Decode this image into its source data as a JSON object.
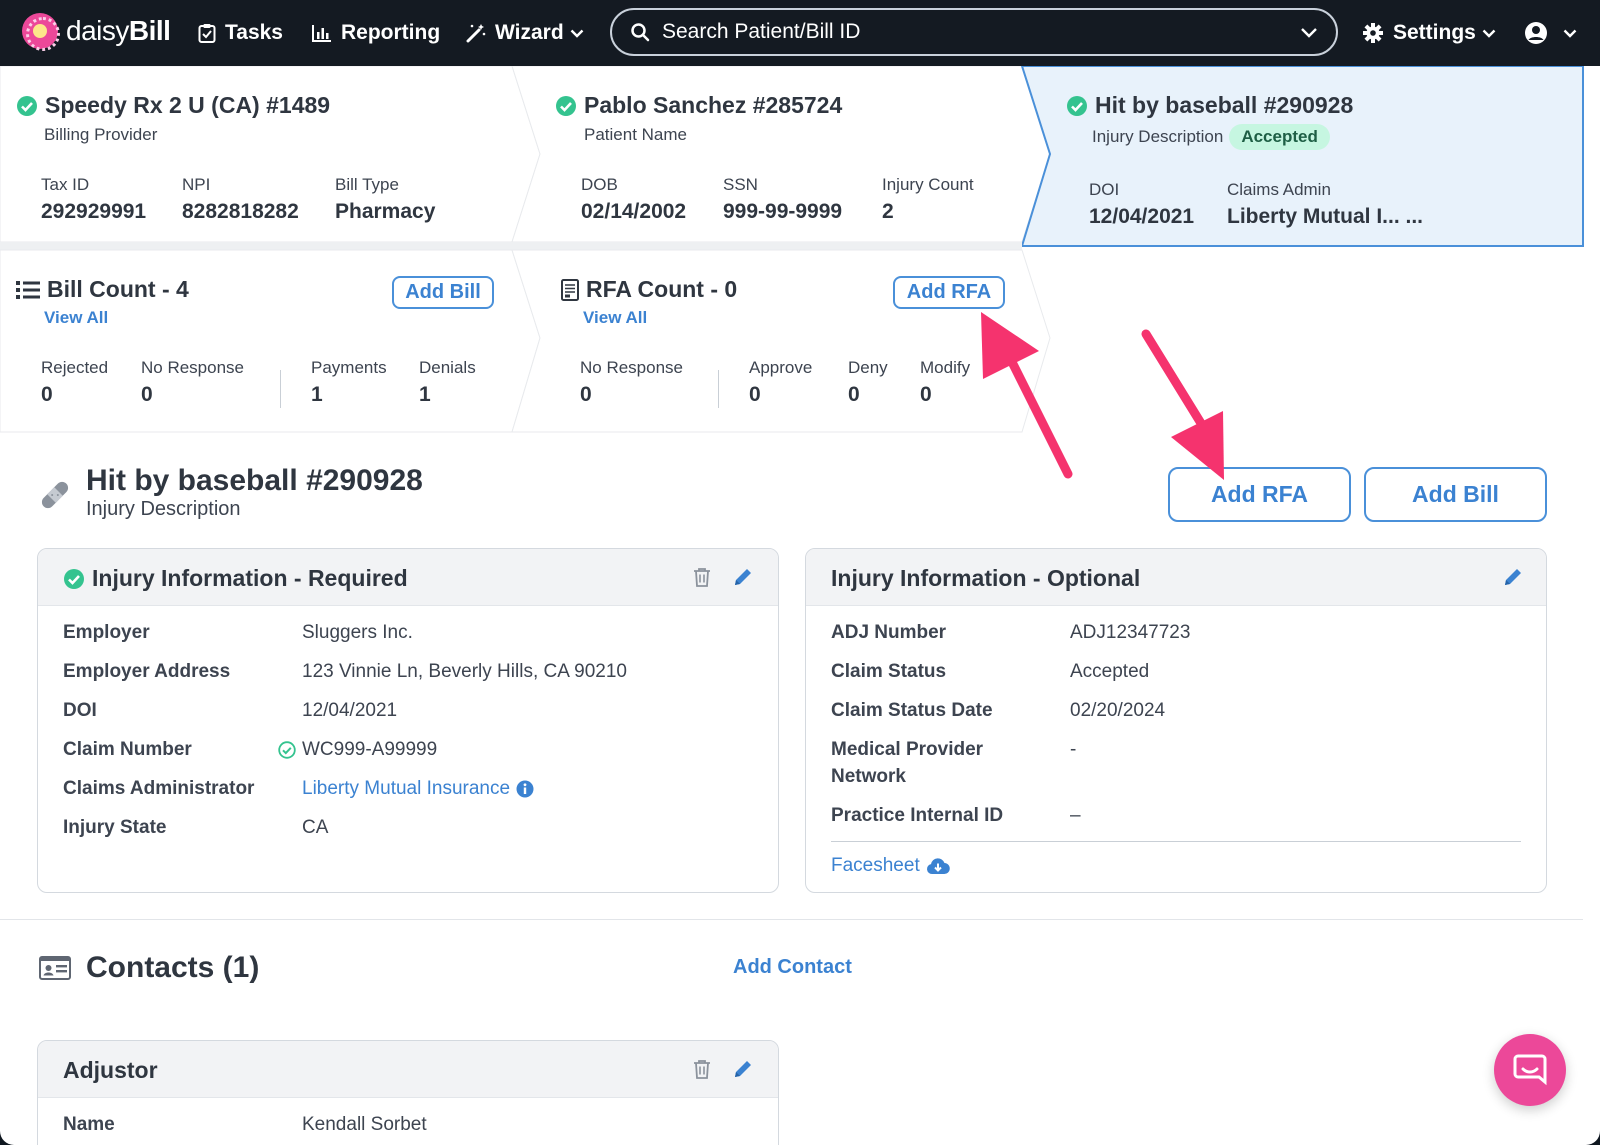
{
  "nav": {
    "brand_light": "daisy",
    "brand_bold": "Bill",
    "tasks": "Tasks",
    "reporting": "Reporting",
    "wizard": "Wizard",
    "search_placeholder": "Search Patient/Bill ID",
    "settings": "Settings"
  },
  "provider": {
    "title": "Speedy Rx 2 U (CA) #1489",
    "subtitle": "Billing Provider",
    "fields": [
      {
        "label": "Tax ID",
        "value": "292929991"
      },
      {
        "label": "NPI",
        "value": "8282818282"
      },
      {
        "label": "Bill Type",
        "value": "Pharmacy"
      }
    ]
  },
  "patient": {
    "title": "Pablo Sanchez #285724",
    "subtitle": "Patient Name",
    "fields": [
      {
        "label": "DOB",
        "value": "02/14/2002"
      },
      {
        "label": "SSN",
        "value": "999-99-9999"
      },
      {
        "label": "Injury Count",
        "value": "2"
      }
    ]
  },
  "injury_panel": {
    "title": "Hit by baseball #290928",
    "subtitle": "Injury Description",
    "badge": "Accepted",
    "fields": [
      {
        "label": "DOI",
        "value": "12/04/2021"
      },
      {
        "label": "Claims Admin",
        "value": "Liberty Mutual I... ..."
      }
    ]
  },
  "bills": {
    "title": "Bill Count - 4",
    "view_all": "View All",
    "add_label": "Add Bill",
    "stats": [
      {
        "label": "Rejected",
        "value": "0"
      },
      {
        "label": "No Response",
        "value": "0"
      },
      {
        "label": "Payments",
        "value": "1"
      },
      {
        "label": "Denials",
        "value": "1"
      }
    ]
  },
  "rfa": {
    "title": "RFA Count - 0",
    "view_all": "View All",
    "add_label": "Add RFA",
    "stats": [
      {
        "label": "No Response",
        "value": "0"
      },
      {
        "label": "Approve",
        "value": "0"
      },
      {
        "label": "Deny",
        "value": "0"
      },
      {
        "label": "Modify",
        "value": "0"
      }
    ]
  },
  "section": {
    "title": "Hit by baseball #290928",
    "subtitle": "Injury Description",
    "add_rfa": "Add RFA",
    "add_bill": "Add Bill"
  },
  "required_card": {
    "title": "Injury Information - Required",
    "rows": [
      {
        "label": "Employer",
        "value": "Sluggers Inc."
      },
      {
        "label": "Employer Address",
        "value": "123 Vinnie Ln, Beverly Hills, CA 90210"
      },
      {
        "label": "DOI",
        "value": "12/04/2021"
      },
      {
        "label": "Claim Number",
        "value": "WC999-A99999"
      },
      {
        "label": "Claims Administrator",
        "value": "Liberty Mutual Insurance"
      },
      {
        "label": "Injury State",
        "value": "CA"
      }
    ]
  },
  "optional_card": {
    "title": "Injury Information - Optional",
    "rows": [
      {
        "label": "ADJ Number",
        "value": "ADJ12347723"
      },
      {
        "label": "Claim Status",
        "value": "Accepted"
      },
      {
        "label": "Claim Status Date",
        "value": "02/20/2024"
      },
      {
        "label": "Medical Provider",
        "label2": "Network",
        "value": "-"
      },
      {
        "label": "Practice Internal ID",
        "value": "–"
      }
    ],
    "facesheet": "Facesheet"
  },
  "contacts": {
    "title": "Contacts (1)",
    "add_label": "Add Contact",
    "card_title": "Adjustor",
    "rows": [
      {
        "label": "Name",
        "value": "Kendall Sorbet"
      }
    ]
  },
  "colors": {
    "nav_bg": "#141a22",
    "accent_blue": "#3b82d1",
    "success_green": "#34c38f",
    "brand_pink": "#ec4899",
    "arrow_pink": "#f5336e",
    "selected_panel": "#e8f2fb"
  }
}
